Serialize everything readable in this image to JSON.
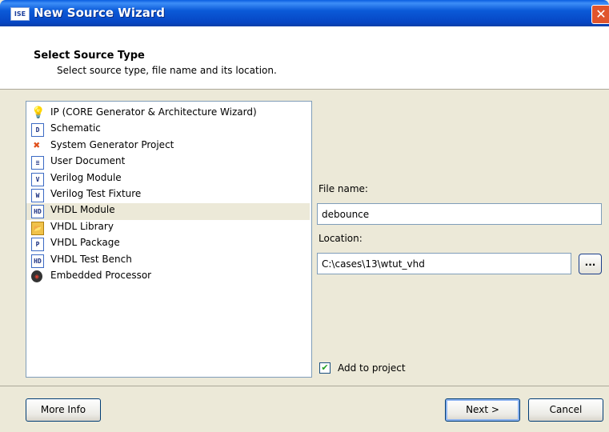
{
  "window": {
    "title": "New Source Wizard",
    "app_icon": "ISE",
    "close_icon": "✕"
  },
  "header": {
    "title": "Select Source Type",
    "subtitle": "Select source type, file name and its location."
  },
  "source_types": [
    {
      "label": "IP (CORE Generator & Architecture Wizard)",
      "icon": "lightbulb-icon",
      "glyph": "💡"
    },
    {
      "label": "Schematic",
      "icon": "schematic-icon",
      "glyph": "D"
    },
    {
      "label": "System Generator Project",
      "icon": "system-generator-icon",
      "glyph": "✖"
    },
    {
      "label": "User Document",
      "icon": "document-icon",
      "glyph": "≡"
    },
    {
      "label": "Verilog Module",
      "icon": "verilog-module-icon",
      "glyph": "V"
    },
    {
      "label": "Verilog Test Fixture",
      "icon": "verilog-test-fixture-icon",
      "glyph": "W"
    },
    {
      "label": "VHDL Module",
      "icon": "vhdl-module-icon",
      "glyph": "HD",
      "selected": true
    },
    {
      "label": "VHDL Library",
      "icon": "vhdl-library-icon",
      "glyph": "📂"
    },
    {
      "label": "VHDL Package",
      "icon": "vhdl-package-icon",
      "glyph": "P"
    },
    {
      "label": "VHDL Test Bench",
      "icon": "vhdl-test-bench-icon",
      "glyph": "HD"
    },
    {
      "label": "Embedded Processor",
      "icon": "embedded-processor-icon",
      "glyph": "◉"
    }
  ],
  "form": {
    "file_name_label": "File name:",
    "file_name_value": "debounce",
    "location_label": "Location:",
    "location_value": "C:\\cases\\13\\wtut_vhd",
    "browse_label": "...",
    "add_to_project_label": "Add to project",
    "add_to_project_checked": true,
    "check_glyph": "✔"
  },
  "buttons": {
    "more_info": "More Info",
    "next": "Next >",
    "cancel": "Cancel"
  }
}
